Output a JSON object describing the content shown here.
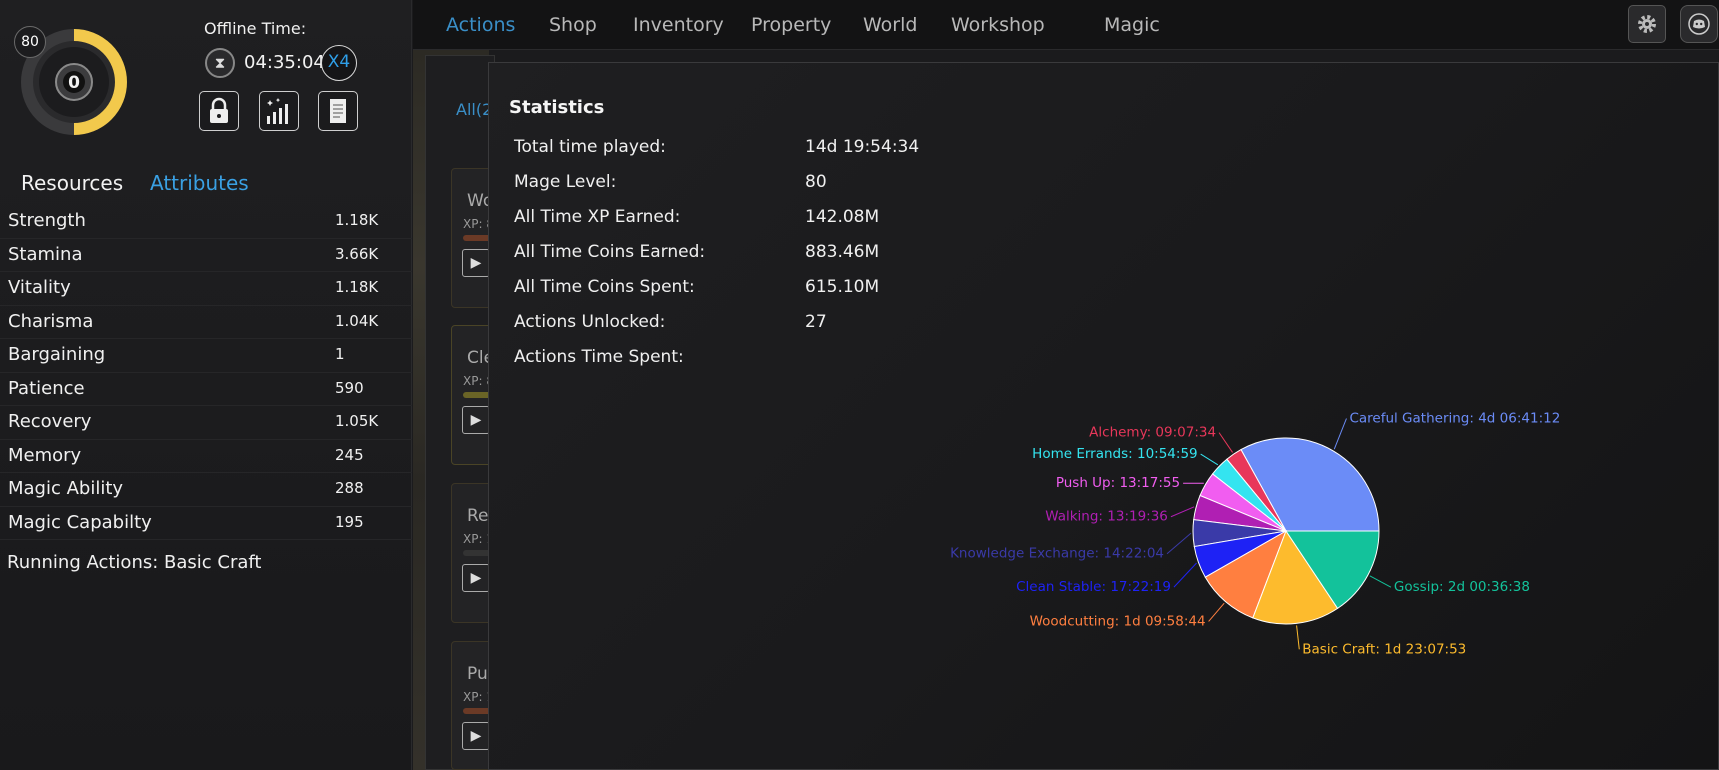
{
  "sidebar": {
    "level": "80",
    "level_center": "0",
    "offline_label": "Offline Time:",
    "offline_time": "04:35:04",
    "speed": "X4",
    "tabs": {
      "resources": "Resources",
      "attributes": "Attributes"
    },
    "attributes": [
      {
        "name": "Strength",
        "value": "1.18K"
      },
      {
        "name": "Stamina",
        "value": "3.66K"
      },
      {
        "name": "Vitality",
        "value": "1.18K"
      },
      {
        "name": "Charisma",
        "value": "1.04K"
      },
      {
        "name": "Bargaining",
        "value": "1"
      },
      {
        "name": "Patience",
        "value": "590"
      },
      {
        "name": "Recovery",
        "value": "1.05K"
      },
      {
        "name": "Memory",
        "value": "245"
      },
      {
        "name": "Magic Ability",
        "value": "288"
      },
      {
        "name": "Magic Capabilty",
        "value": "195"
      }
    ],
    "running_actions": "Running Actions:  Basic Craft"
  },
  "nav": {
    "items": [
      "Actions",
      "Shop",
      "Inventory",
      "Property",
      "World",
      "Workshop",
      "Magic"
    ],
    "active": "Actions"
  },
  "background": {
    "tab": "All(2",
    "cards": [
      {
        "title": "Wo",
        "xp": "XP: 8"
      },
      {
        "title": "Cle",
        "xp": "XP: 8"
      },
      {
        "title": "Re",
        "xp": "XP: 1"
      },
      {
        "title": "Pu",
        "xp": "XP: 1"
      }
    ]
  },
  "stats": {
    "title": "Statistics",
    "rows": [
      {
        "label": "Total time played:",
        "value": "14d 19:54:34"
      },
      {
        "label": "Mage  Level:",
        "value": "80"
      },
      {
        "label": "All Time XP  Earned:",
        "value": "142.08M"
      },
      {
        "label": "All Time Coins  Earned:",
        "value": "883.46M"
      },
      {
        "label": "All Time Coins Spent:",
        "value": "615.10M"
      },
      {
        "label": "Actions Unlocked:",
        "value": "27"
      },
      {
        "label": "Actions Time Spent:",
        "value": ""
      }
    ]
  },
  "colors": {
    "accent": "#3a8fc8",
    "level_ring": "#f2c94c"
  },
  "chart_data": {
    "type": "pie",
    "title": "",
    "unit": "seconds",
    "slices": [
      {
        "label": "Careful Gathering: 4d 06:41:12",
        "value": 369672,
        "color": "#6b8cf7"
      },
      {
        "label": "Alchemy: 09:07:34",
        "value": 32854,
        "color": "#e8375a"
      },
      {
        "label": "Home  Errands: 10:54:59",
        "value": 39299,
        "color": "#34e4f0"
      },
      {
        "label": "Push Up: 13:17:55",
        "value": 47875,
        "color": "#f15df0"
      },
      {
        "label": "Walking: 13:19:36",
        "value": 47976,
        "color": "#b01fb3"
      },
      {
        "label": "Knowledge  Exchange: 14:22:04",
        "value": 51724,
        "color": "#3a3aa8"
      },
      {
        "label": "Clean Stable: 17:22:19",
        "value": 62539,
        "color": "#1e22f5"
      },
      {
        "label": "Woodcutting: 1d 09:58:44",
        "value": 122324,
        "color": "#ff7f40"
      },
      {
        "label": "Basic Craft: 1d 23:07:53",
        "value": 169673,
        "color": "#fdbb2d"
      },
      {
        "label": "Gossip: 2d 00:36:38",
        "value": 174998,
        "color": "#13c29b"
      }
    ]
  }
}
